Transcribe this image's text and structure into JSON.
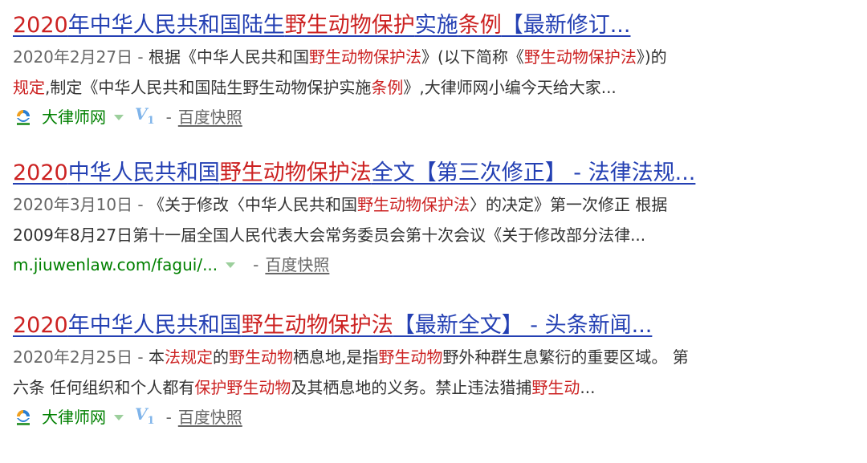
{
  "results": [
    {
      "title_parts": [
        {
          "t": "2020",
          "hl": true
        },
        {
          "t": "年中华人民共和国陆生",
          "hl": false
        },
        {
          "t": "野生动物保护",
          "hl": true
        },
        {
          "t": "实施",
          "hl": false
        },
        {
          "t": "条例",
          "hl": true
        },
        {
          "t": "【最新修订...",
          "hl": false
        }
      ],
      "date": "2020年2月27日 - ",
      "abstract_lines": [
        [
          {
            "t": "根据《中华人民共和国",
            "hl": false
          },
          {
            "t": "野生动物保护法",
            "hl": true
          },
          {
            "t": "》(以下简称《",
            "hl": false
          },
          {
            "t": "野生动物保护法",
            "hl": true
          },
          {
            "t": "》)的",
            "hl": false
          }
        ],
        [
          {
            "t": "规定",
            "hl": true
          },
          {
            "t": ",制定《中华人民共和国陆生野生动物保护实施",
            "hl": false
          },
          {
            "t": "条例",
            "hl": true
          },
          {
            "t": "》,大律师网小编今天给大家...",
            "hl": false
          }
        ]
      ],
      "source_type": "site",
      "site_name": "大律师网",
      "v_badge": "V",
      "v_level": "1",
      "separator": " - ",
      "snapshot": "百度快照"
    },
    {
      "title_parts": [
        {
          "t": "2020",
          "hl": true
        },
        {
          "t": "中华人民共和国",
          "hl": false
        },
        {
          "t": "野生动物保护法",
          "hl": true
        },
        {
          "t": "全文【第三次修正】 - 法律法规...",
          "hl": false
        }
      ],
      "date": "2020年3月10日 - ",
      "abstract_lines": [
        [
          {
            "t": "《关于修改〈中华人民共和国",
            "hl": false
          },
          {
            "t": "野生动物保护法",
            "hl": true
          },
          {
            "t": "〉的决定》第一次修正 根据",
            "hl": false
          }
        ],
        [
          {
            "t": "2009年8月27日第十一届全国人民代表大会常务委员会第十次会议《关于修改部分法律...",
            "hl": false
          }
        ]
      ],
      "source_type": "url",
      "site_url": "m.jiuwenlaw.com/fagui/...",
      "separator": " - ",
      "snapshot": "百度快照"
    },
    {
      "title_parts": [
        {
          "t": "2020",
          "hl": true
        },
        {
          "t": "年中华人民共和国",
          "hl": false
        },
        {
          "t": "野生动物保护法",
          "hl": true
        },
        {
          "t": "【最新全文】 - 头条新闻...",
          "hl": false
        }
      ],
      "date": "2020年2月25日 - ",
      "abstract_lines": [
        [
          {
            "t": "本",
            "hl": false
          },
          {
            "t": "法规定",
            "hl": true
          },
          {
            "t": "的",
            "hl": false
          },
          {
            "t": "野生动物",
            "hl": true
          },
          {
            "t": "栖息地,是指",
            "hl": false
          },
          {
            "t": "野生动物",
            "hl": true
          },
          {
            "t": "野外种群生息繁衍的重要区域。 第",
            "hl": false
          }
        ],
        [
          {
            "t": "六条 任何组织和个人都有",
            "hl": false
          },
          {
            "t": "保护野生动物",
            "hl": true
          },
          {
            "t": "及其栖息地的义务。禁止违法猎捕",
            "hl": false
          },
          {
            "t": "野生动",
            "hl": true
          },
          {
            "t": "...",
            "hl": false
          }
        ]
      ],
      "source_type": "site",
      "site_name": "大律师网",
      "v_badge": "V",
      "v_level": "1",
      "separator": " - ",
      "snapshot": "百度快照"
    }
  ],
  "colors": {
    "title": "#2440b3",
    "highlight": "#cc2222",
    "site": "#008000",
    "meta": "#666666",
    "text": "#333333",
    "v_badge": "#7fb4ea"
  },
  "icons": {
    "site_logo": "dalvshi-logo-icon",
    "dropdown": "chevron-down-icon"
  }
}
